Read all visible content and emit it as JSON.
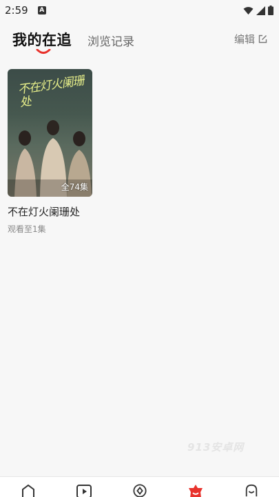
{
  "status_bar": {
    "time": "2:59",
    "app_icon_letter": "A"
  },
  "header": {
    "tab_following": "我的在追",
    "tab_history": "浏览记录",
    "edit_label": "编辑"
  },
  "following_list": [
    {
      "poster_title": "不在灯火阑珊处",
      "episodes": "全74集",
      "title": "不在灯火阑珊处",
      "progress": "观看至1集"
    }
  ],
  "watermark": "913安卓网",
  "bottom_nav": {
    "items": [
      {
        "icon": "home-icon",
        "active": false
      },
      {
        "icon": "play-icon",
        "active": false
      },
      {
        "icon": "discover-icon",
        "active": false
      },
      {
        "icon": "following-icon",
        "active": true
      },
      {
        "icon": "profile-icon",
        "active": false
      }
    ],
    "active_color": "#e8322c",
    "inactive_color": "#333333"
  }
}
